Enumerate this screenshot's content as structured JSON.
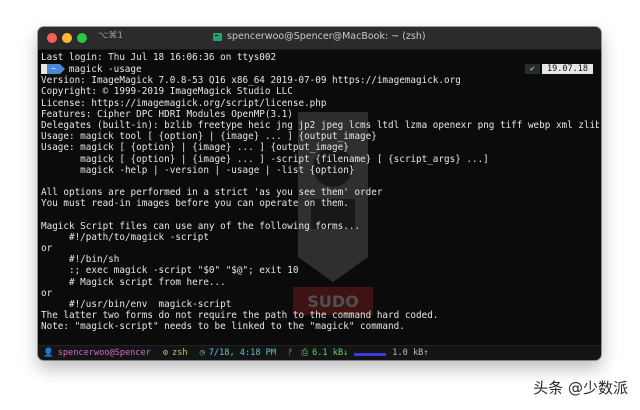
{
  "titlebar": {
    "shortcut": "⌥⌘1",
    "title": "spencerwoo@Spencer@MacBook: ~ (zsh)"
  },
  "prompt": {
    "apple_glyph": "",
    "home_glyph": "~",
    "command": "magick -usage"
  },
  "right_status": {
    "check": "✔",
    "date": "19.07.18"
  },
  "terminal": {
    "lines": [
      "Last login: Thu Jul 18 16:06:36 on ttys002",
      "",
      "Version: ImageMagick 7.0.8-53 Q16 x86_64 2019-07-09 https://imagemagick.org",
      "Copyright: © 1999-2019 ImageMagick Studio LLC",
      "License: https://imagemagick.org/script/license.php",
      "Features: Cipher DPC HDRI Modules OpenMP(3.1)",
      "Delegates (built-in): bzlib freetype heic jng jp2 jpeg lcms ltdl lzma openexr png tiff webp xml zlib",
      "Usage: magick tool [ {option} | {image} ... ] {output_image}",
      "Usage: magick [ {option} | {image} ... ] {output_image}",
      "       magick [ {option} | {image} ... ] -script {filename} [ {script_args} ...]",
      "       magick -help | -version | -usage | -list {option}",
      "",
      "All options are performed in a strict 'as you see them' order",
      "You must read-in images before you can operate on them.",
      "",
      "Magick Script files can use any of the following forms...",
      "     #!/path/to/magick -script",
      "or",
      "     #!/bin/sh",
      "     :; exec magick -script \"$0\" \"$@\"; exit 10",
      "     # Magick script from here...",
      "or",
      "     #!/usr/bin/env  magick-script",
      "The latter two forms do not require the path to the command hard coded.",
      "Note: \"magick-script\" needs to be linked to the \"magick\" command."
    ]
  },
  "statusbar": {
    "user_icon": "👤",
    "user": "spencerwoo@Spencer",
    "shell_icon": "⚙",
    "shell": "zsh",
    "time_icon": "◷",
    "time": "7/18, 4:18 PM",
    "branch_icon": "ᚠ",
    "down_icon": "⎙",
    "down": "6.1 kB↓",
    "up": "1.0 kB↑"
  },
  "watermark_text": "SUDO",
  "footer_watermark": "头条 @少数派",
  "colors": {
    "accent_blue": "#4a87d6",
    "status_user": "#d36ac6",
    "status_time": "#5fc4c4",
    "status_net": "#5fd35f"
  }
}
